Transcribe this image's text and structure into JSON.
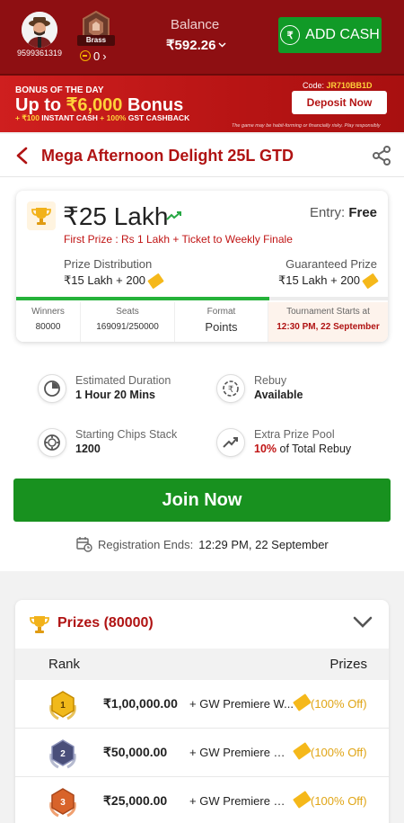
{
  "header": {
    "user_phone": "9599361319",
    "rank": "Brass",
    "coins": "0",
    "balance_label": "Balance",
    "balance_value": "₹592.26",
    "add_cash_label": "ADD CASH"
  },
  "banner": {
    "kicker": "BONUS OF THE DAY",
    "title_prefix": "Up to ",
    "title_amount": "₹6,000",
    "title_suffix": " Bonus",
    "sub_1": "+ ₹100",
    "sub_2": " INSTANT CASH ",
    "sub_3": "+ 100%",
    "sub_4": " GST CASHBACK",
    "code_label": "Code: ",
    "code": "JR710BB1D",
    "deposit_label": "Deposit Now",
    "disclaimer": "The game may be habit-forming or financially risky. Play responsibly"
  },
  "page": {
    "title": "Mega Afternoon Delight 25L GTD"
  },
  "tournament": {
    "prize_amount": "₹25 Lakh",
    "entry_label": "Entry: ",
    "entry_value": "Free",
    "first_prize": "First Prize : Rs 1 Lakh + Ticket to Weekly Finale",
    "prize_distribution_label": "Prize Distribution",
    "prize_distribution_value": "₹15 Lakh + 200",
    "guaranteed_prize_label": "Guaranteed Prize",
    "guaranteed_prize_value": "₹15 Lakh + 200",
    "seats_filled_fraction": 0.68,
    "stats": {
      "winners_label": "Winners",
      "winners_value": "80000",
      "seats_label": "Seats",
      "seats_value": "169091/250000",
      "format_label": "Format",
      "format_value": "Points",
      "starts_label": "Tournament Starts at",
      "starts_value": "12:30 PM, 22 September"
    }
  },
  "info": {
    "duration_label": "Estimated Duration",
    "duration_value": "1 Hour 20 Mins",
    "rebuy_label": "Rebuy",
    "rebuy_value": "Available",
    "chips_label": "Starting Chips Stack",
    "chips_value": "1200",
    "extra_label": "Extra Prize Pool",
    "extra_pct": "10%",
    "extra_suffix": " of Total Rebuy"
  },
  "actions": {
    "join_label": "Join Now",
    "reg_label": "Registration Ends: ",
    "reg_value": "12:29 PM, 22 September"
  },
  "prizes": {
    "title": "Prizes (80000)",
    "col_rank": "Rank",
    "col_prizes": "Prizes",
    "rows": [
      {
        "rank": "1",
        "amount": "₹1,00,000.00",
        "desc": "+ GW Premiere W...",
        "off": "(100% Off)",
        "medal_color": "#f1b91a"
      },
      {
        "rank": "2",
        "amount": "₹50,000.00",
        "desc": "+ GW Premiere Wee...",
        "off": "(100% Off)",
        "medal_color": "#4a4f7a"
      },
      {
        "rank": "3",
        "amount": "₹25,000.00",
        "desc": "+ GW Premiere Wee...",
        "off": "(100% Off)",
        "medal_color": "#d8632a"
      }
    ]
  },
  "colors": {
    "brand_red": "#8e0f12",
    "accent_red": "#b01313",
    "cta_green": "#18911f",
    "gold": "#f5b81a"
  }
}
